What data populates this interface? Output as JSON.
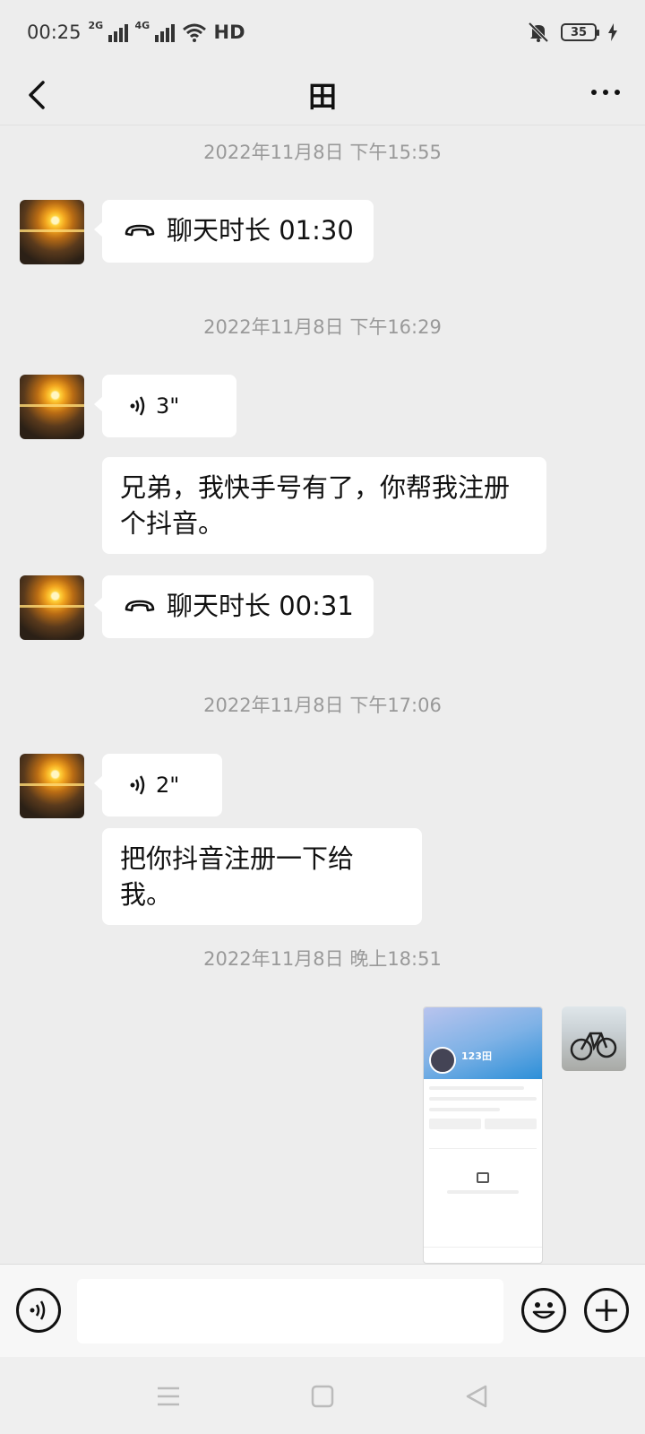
{
  "status_bar": {
    "time": "00:25",
    "net1": "2G",
    "net2": "4G",
    "hd": "HD",
    "battery": "35"
  },
  "nav": {
    "title": "田"
  },
  "messages": [
    {
      "type": "timestamp",
      "text": "2022年11月8日 下午15:55"
    },
    {
      "type": "call",
      "text": "聊天时长 01:30"
    },
    {
      "type": "timestamp",
      "text": "2022年11月8日 下午16:29"
    },
    {
      "type": "voice",
      "text": "3\""
    },
    {
      "type": "text",
      "text": "兄弟，我快手号有了，你帮我注册个抖音。"
    },
    {
      "type": "call",
      "text": "聊天时长 00:31"
    },
    {
      "type": "timestamp",
      "text": "2022年11月8日 下午17:06"
    },
    {
      "type": "voice",
      "text": "2\""
    },
    {
      "type": "text",
      "text": "把你抖音注册一下给我。"
    },
    {
      "type": "timestamp",
      "text": "2022年11月8日 晚上18:51"
    }
  ],
  "shot": {
    "name": "123田"
  },
  "input": {
    "placeholder": ""
  },
  "icons": {
    "back": "chevron-left-icon",
    "more": "more-dots-icon",
    "voice_toggle": "voice-icon",
    "emoji": "emoji-icon",
    "plus": "plus-icon"
  }
}
